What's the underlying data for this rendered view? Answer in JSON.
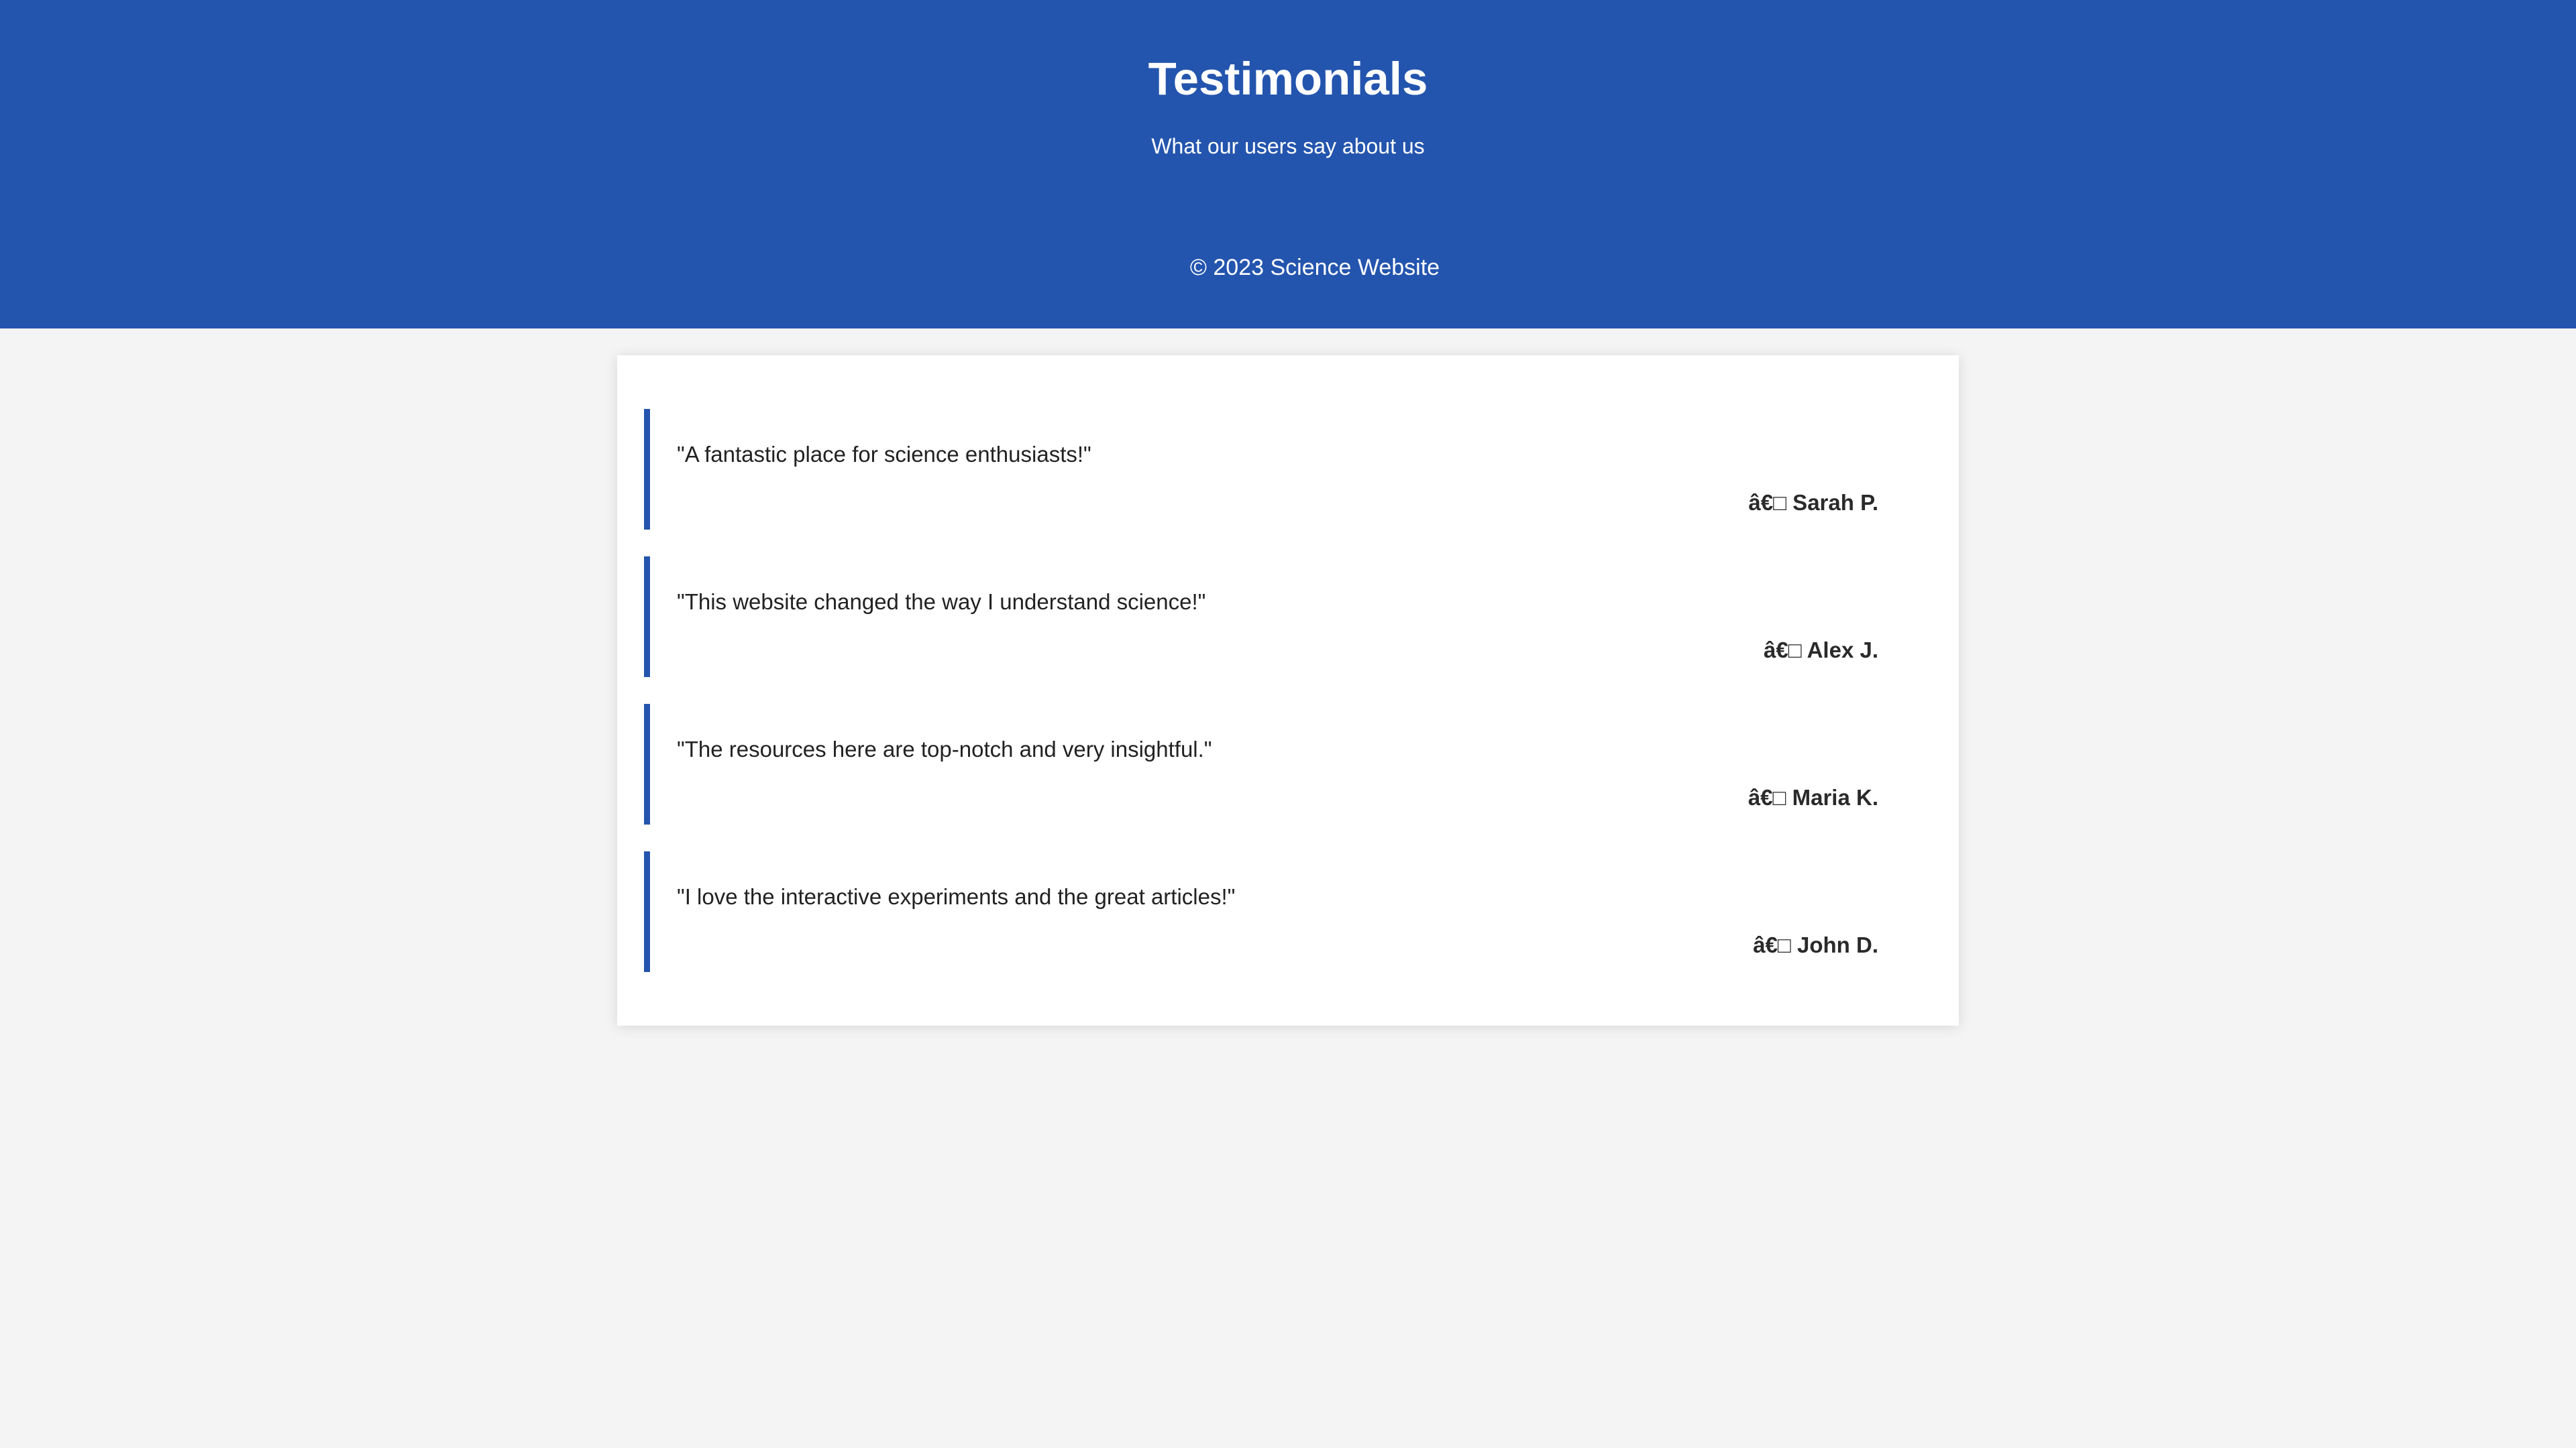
{
  "header": {
    "title": "Testimonials",
    "subtitle": "What our users say about us",
    "footer": "© 2023 Science Website"
  },
  "testimonials": [
    {
      "quote": "\"A fantastic place for science enthusiasts!\"",
      "author": "â€□ Sarah P."
    },
    {
      "quote": "\"This website changed the way I understand science!\"",
      "author": "â€□ Alex J."
    },
    {
      "quote": "\"The resources here are top-notch and very insightful.\"",
      "author": "â€□ Maria K."
    },
    {
      "quote": "\"I love the interactive experiments and the great articles!\"",
      "author": "â€□ John D."
    }
  ],
  "colors": {
    "brand": "#2455ae",
    "page_background": "#f4f4f4",
    "card_background": "#ffffff"
  }
}
